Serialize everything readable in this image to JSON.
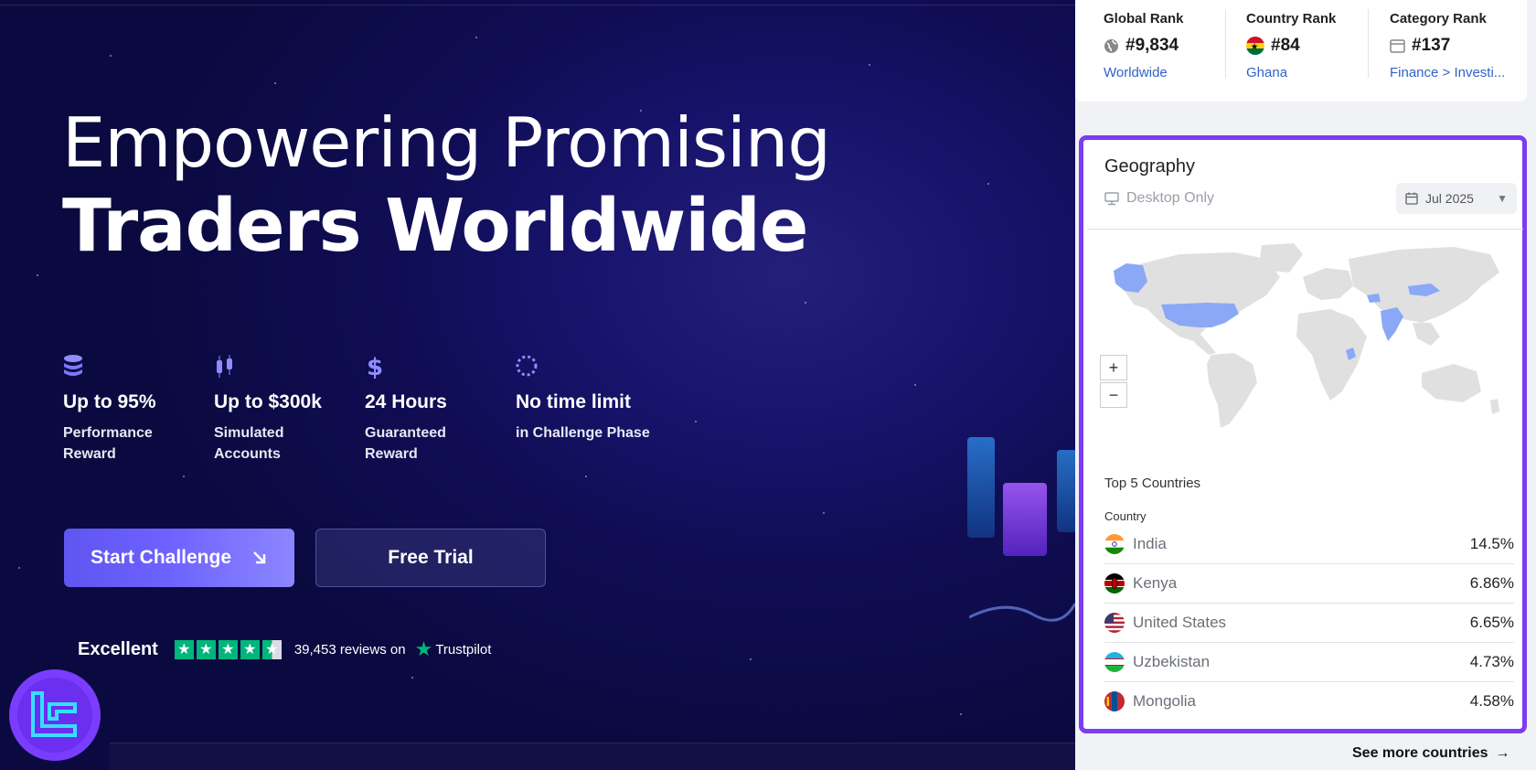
{
  "hero": {
    "headline_line1": "Empowering Promising",
    "headline_line2": "Traders Worldwide",
    "features": [
      {
        "icon": "coins-stack-icon",
        "title": "Up to 95%",
        "subtitle": "Performance Reward"
      },
      {
        "icon": "candlestick-icon",
        "title": "Up to $300k",
        "subtitle": "Simulated Accounts"
      },
      {
        "icon": "dollar-icon",
        "title": "24 Hours",
        "subtitle": "Guaranteed Reward"
      },
      {
        "icon": "dashed-circle-icon",
        "title": "No time limit",
        "subtitle": "in Challenge Phase"
      }
    ],
    "start_button": "Start Challenge",
    "free_trial_button": "Free Trial",
    "trustpilot": {
      "rating_text": "Excellent",
      "stars": 4.5,
      "reviews": "39,453 reviews on",
      "brand": "Trustpilot"
    }
  },
  "ranks": {
    "global": {
      "label": "Global Rank",
      "value": "#9,834",
      "link": "Worldwide",
      "icon": "globe-icon"
    },
    "country": {
      "label": "Country Rank",
      "value": "#84",
      "link": "Ghana",
      "icon": "ghana-flag-icon"
    },
    "category": {
      "label": "Category Rank",
      "value": "#137",
      "link": "Finance > Investi...",
      "icon": "category-card-icon"
    }
  },
  "geography": {
    "title": "Geography",
    "device_filter": "Desktop Only",
    "date_selector": "Jul 2025",
    "zoom_in": "+",
    "zoom_out": "−",
    "top_title": "Top 5 Countries",
    "column_header": "Country",
    "countries": [
      {
        "name": "India",
        "share": "14.5%"
      },
      {
        "name": "Kenya",
        "share": "6.86%"
      },
      {
        "name": "United States",
        "share": "6.65%"
      },
      {
        "name": "Uzbekistan",
        "share": "4.73%"
      },
      {
        "name": "Mongolia",
        "share": "4.58%"
      }
    ],
    "see_more": "See more countries",
    "colors": {
      "accent_border": "#7d3cf0",
      "map_highlight": "#8aa8f5",
      "map_base": "#e0e0e0"
    }
  }
}
